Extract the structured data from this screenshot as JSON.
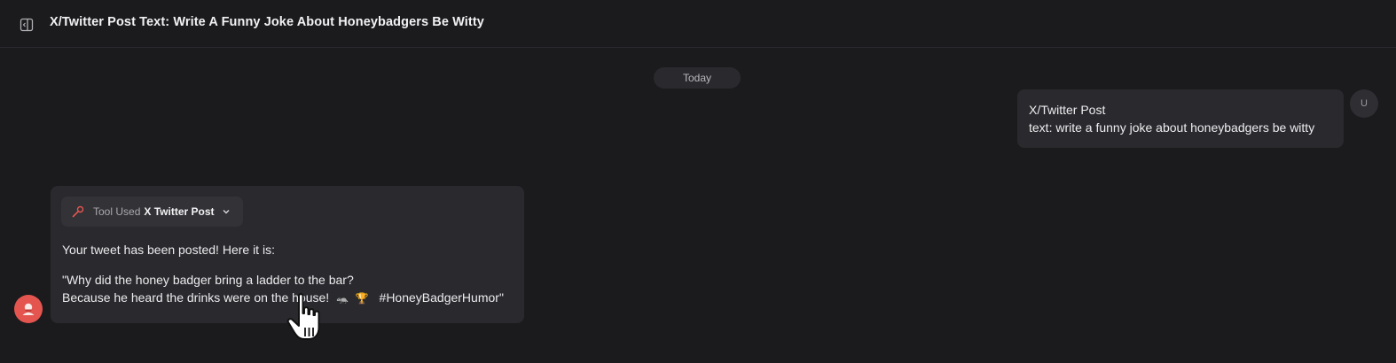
{
  "header": {
    "title": "X/Twitter Post Text: Write A Funny Joke About Honeybadgers Be Witty",
    "toggle_icon": "sidebar-toggle-icon"
  },
  "conversation": {
    "date_divider": "Today",
    "user_message": {
      "avatar_initial": "U",
      "lines": [
        "X/Twitter Post",
        "text: write a funny joke about honeybadgers be witty"
      ]
    },
    "assistant_message": {
      "tool": {
        "prefix": "Tool Used",
        "name": "X Twitter Post",
        "icon": "tool-icon",
        "chevron": "chevron-down-icon"
      },
      "line1": "Your tweet has been posted! Here it is:",
      "line2": "\"Why did the honey badger bring a ladder to the bar?",
      "line3_text": "Because he heard the drinks were on the house!",
      "line3_emoji_1": "🦡",
      "line3_emoji_2": "🏆",
      "line3_hashtag": "#HoneyBadgerHumor\""
    }
  },
  "colors": {
    "background": "#1b1b1d",
    "bubble": "#2a2a2e",
    "bot_avatar": "#e5554f",
    "tool_icon": "#e5554f"
  }
}
